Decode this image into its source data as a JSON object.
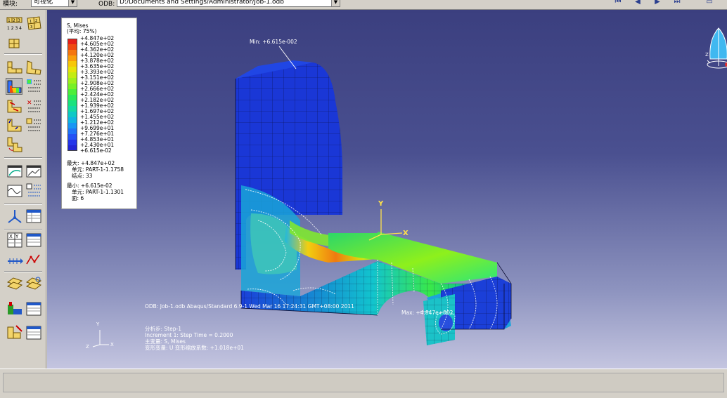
{
  "topbar": {
    "module_label": "模块:",
    "module_value": "可视化",
    "model_label": "ODB:",
    "model_value": "D:/Documents and Settings/Administrator/Job-1.odb"
  },
  "legend": {
    "title_lines": [
      "S, Mises",
      "(平均: 75%)"
    ],
    "values": [
      "+4.847e+02",
      "+4.605e+02",
      "+4.362e+02",
      "+4.120e+02",
      "+3.878e+02",
      "+3.635e+02",
      "+3.393e+02",
      "+3.151e+02",
      "+2.908e+02",
      "+2.666e+02",
      "+2.424e+02",
      "+2.182e+02",
      "+1.939e+02",
      "+1.697e+02",
      "+1.455e+02",
      "+1.212e+02",
      "+9.699e+01",
      "+7.276e+01",
      "+4.853e+01",
      "+2.430e+01",
      "+6.615e-02"
    ],
    "colors": [
      "#e6201a",
      "#f04a12",
      "#f5760e",
      "#f99f0a",
      "#f7c708",
      "#e7e30a",
      "#c4ec12",
      "#9ff01c",
      "#78f026",
      "#4cee3a",
      "#29e95a",
      "#19e27e",
      "#12d9a3",
      "#0ec9c6",
      "#10b4e2",
      "#1896f4",
      "#1f74f8",
      "#2352f5",
      "#2536ea",
      "#2326d6"
    ],
    "max_label": "最大: +4.847e+02",
    "max_elem": "单元: PART-1-1.1758",
    "max_node": "结点: 33",
    "min_label": "最小: +6.615e-02",
    "min_elem": "单元: PART-1-1.1301",
    "min_node": "面: 6"
  },
  "viewport": {
    "min_marker": "Min: +6.615e-002",
    "max_marker": "Max: +4.847e+002",
    "odb_line": "ODB: Job-1.odb    Abaqus/Standard 6.9-1    Wed Mar 16 17:24:31 GMT+08:00 2011",
    "step_line": "分析步: Step-1",
    "increment_line": "Increment      1: Step Time =    0.2000",
    "primary_line": "主变量: S, Mises",
    "deformed_line": "变形变量: U   变形缩放系数: +1.018e+01",
    "axis_x": "X",
    "axis_y": "Y",
    "triad_x": "X",
    "triad_y": "Y",
    "triad_z": "Z",
    "cube_z": "Z"
  }
}
